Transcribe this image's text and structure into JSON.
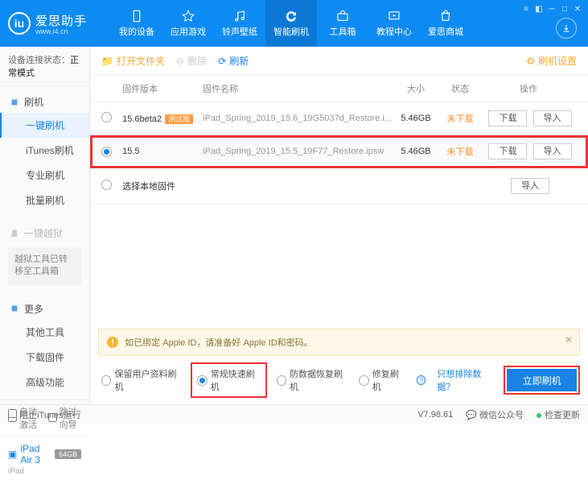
{
  "app": {
    "name": "爱思助手",
    "url": "www.i4.cn"
  },
  "nav": {
    "items": [
      {
        "label": "我的设备"
      },
      {
        "label": "应用游戏"
      },
      {
        "label": "铃声壁纸"
      },
      {
        "label": "智能刷机"
      },
      {
        "label": "工具箱"
      },
      {
        "label": "教程中心"
      },
      {
        "label": "爱思商城"
      }
    ]
  },
  "connection": {
    "prefix": "设备连接状态：",
    "status": "正常模式"
  },
  "sidebar": {
    "flash_group": "刷机",
    "items_flash": [
      "一键刷机",
      "iTunes刷机",
      "专业刷机",
      "批量刷机"
    ],
    "jailbreak_group": "一键越狱",
    "jailbreak_note": "越狱工具已转移至工具箱",
    "more_group": "更多",
    "items_more": [
      "其他工具",
      "下载固件",
      "高级功能"
    ],
    "chk_auto": "自动激活",
    "chk_skip": "跳过向导",
    "device": {
      "name": "iPad Air 3",
      "storage": "64GB",
      "type": "iPad"
    }
  },
  "toolbar": {
    "open": "打开文件夹",
    "delete": "删除",
    "refresh": "刷新",
    "settings": "刷机设置"
  },
  "table": {
    "headers": {
      "ver": "固件版本",
      "name": "固件名称",
      "size": "大小",
      "status": "状态",
      "ops": "操作"
    },
    "rows": [
      {
        "ver": "15.6beta2",
        "beta": "测试版",
        "name": "iPad_Spring_2019_15.6_19G5037d_Restore.i...",
        "size": "5.46GB",
        "status": "未下载"
      },
      {
        "ver": "15.5",
        "name": "iPad_Spring_2019_15.5_19F77_Restore.ipsw",
        "size": "5.46GB",
        "status": "未下载"
      }
    ],
    "btn_download": "下载",
    "btn_import": "导入",
    "local_firmware": "选择本地固件"
  },
  "warn": "如已绑定 Apple ID，请准备好 Apple ID和密码。",
  "modes": {
    "keep": "保留用户资料刷机",
    "normal": "常规快速刷机",
    "recover": "防数据恢复刷机",
    "repair": "修复刷机",
    "exclude": "只想排除数据？",
    "flash": "立即刷机"
  },
  "footer": {
    "block_itunes": "阻止iTunes运行",
    "version": "V7.98.61",
    "wechat": "微信公众号",
    "update": "检查更新"
  }
}
